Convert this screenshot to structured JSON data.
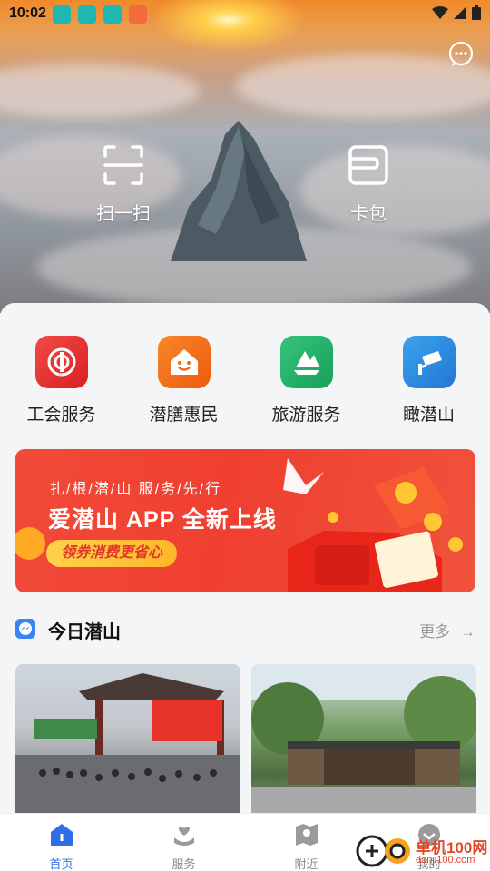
{
  "status": {
    "time": "10:02"
  },
  "hero": {
    "actions": [
      {
        "label": "扫一扫",
        "icon": "scan-icon"
      },
      {
        "label": "卡包",
        "icon": "card-wallet-icon"
      }
    ],
    "message_icon": "chat-bubble-icon"
  },
  "services": [
    {
      "label": "工会服务",
      "icon": "trade-union-icon",
      "color": "#e8322d"
    },
    {
      "label": "潜膳惠民",
      "icon": "house-smile-icon",
      "color": "#f2711c"
    },
    {
      "label": "旅游服务",
      "icon": "mountain-boat-icon",
      "color": "#22b266"
    },
    {
      "label": "瞰潜山",
      "icon": "camera-cctv-icon",
      "color": "#2e8bdf"
    }
  ],
  "banner": {
    "slogan": "扎/根/潜/山   服/务/先/行",
    "title": "爱潜山 APP 全新上线",
    "pill": "领券消费更省心"
  },
  "section": {
    "title": "今日潜山",
    "more": "更多"
  },
  "tabs": [
    {
      "label": "首页",
      "icon": "home-icon",
      "active": true
    },
    {
      "label": "服务",
      "icon": "service-hand-icon",
      "active": false
    },
    {
      "label": "附近",
      "icon": "map-pin-icon",
      "active": false
    },
    {
      "label": "我的",
      "icon": "profile-icon",
      "active": false
    }
  ],
  "watermark": {
    "title": "单机100网",
    "url": "danji100.com"
  }
}
